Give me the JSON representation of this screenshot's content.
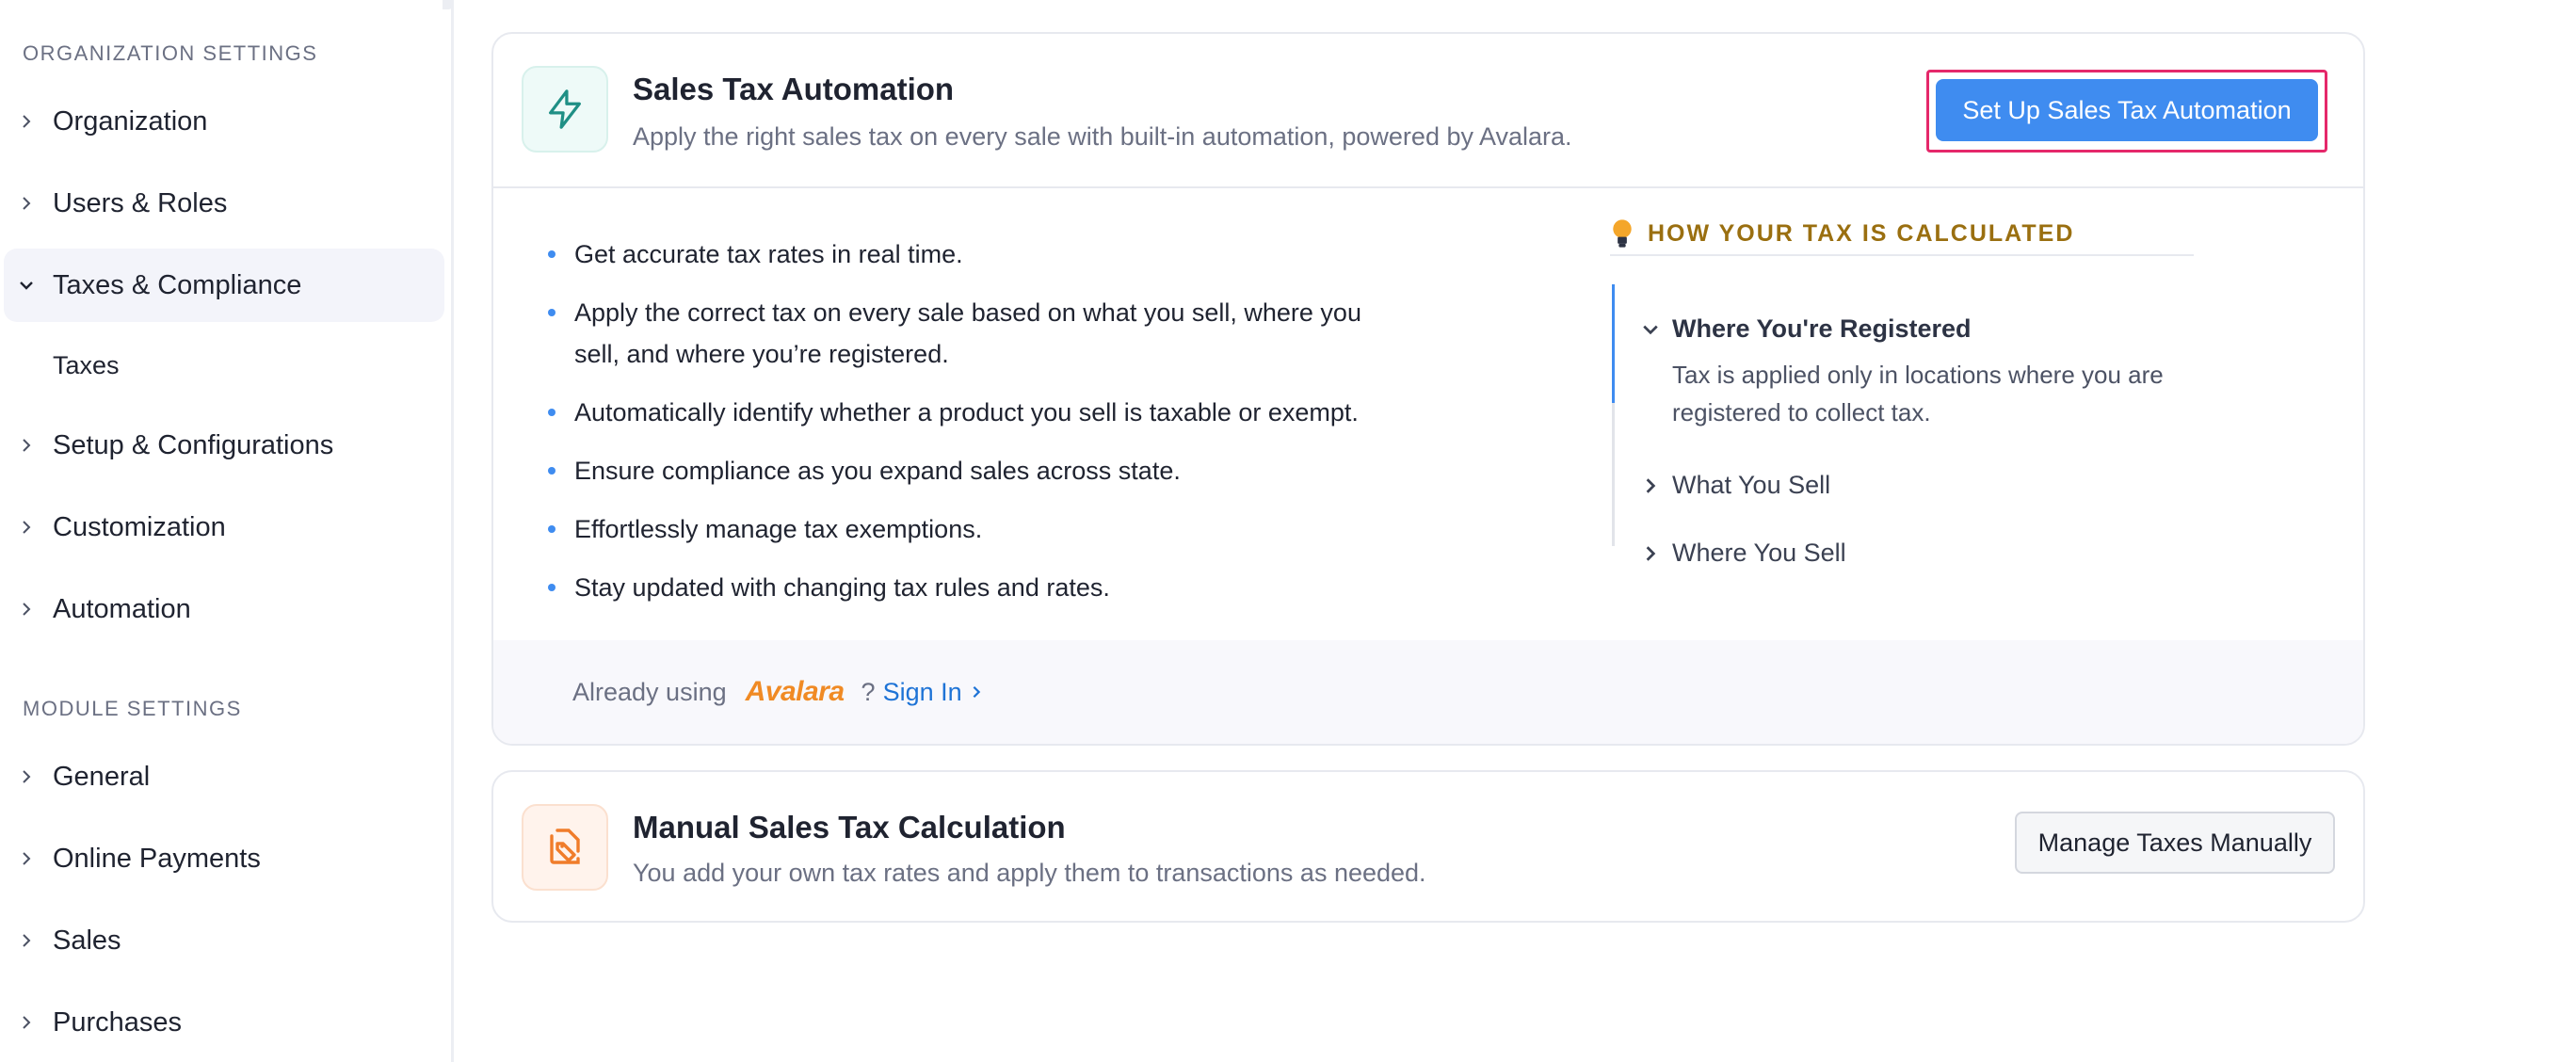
{
  "sidebar": {
    "org_section": "ORGANIZATION SETTINGS",
    "org_items": [
      {
        "label": "Organization"
      },
      {
        "label": "Users & Roles"
      },
      {
        "label": "Taxes & Compliance",
        "expanded": true
      },
      {
        "label": "Setup & Configurations"
      },
      {
        "label": "Customization"
      },
      {
        "label": "Automation"
      }
    ],
    "sub_item": "Taxes",
    "module_section": "MODULE SETTINGS",
    "module_items": [
      {
        "label": "General"
      },
      {
        "label": "Online Payments"
      },
      {
        "label": "Sales"
      },
      {
        "label": "Purchases"
      }
    ]
  },
  "automation_card": {
    "icon": "lightning-icon",
    "title": "Sales Tax Automation",
    "description": "Apply the right sales tax on every sale with built-in automation, powered by Avalara.",
    "button_label": "Set Up Sales Tax Automation",
    "bullets": [
      "Get accurate tax rates in real time.",
      "Apply the correct tax on every sale based on what you sell, where you sell, and where you’re registered.",
      "Automatically identify whether a product you sell is taxable or exempt.",
      "Ensure compliance as you expand sales across state.",
      "Effortlessly manage tax exemptions.",
      "Stay updated with changing tax rules and rates."
    ],
    "how": {
      "heading": "HOW YOUR TAX IS CALCULATED",
      "items": [
        {
          "label": "Where You're Registered",
          "expanded": true,
          "body": "Tax is applied only in locations where you are registered to collect tax."
        },
        {
          "label": "What You Sell",
          "expanded": false
        },
        {
          "label": "Where You Sell",
          "expanded": false
        }
      ]
    },
    "footer": {
      "prefix": "Already using",
      "brand": "Avalara",
      "question": "?",
      "sign_in": "Sign In"
    }
  },
  "manual_card": {
    "icon": "document-tag-icon",
    "title": "Manual Sales Tax Calculation",
    "description": "You add your own tax rates and apply them to transactions as needed.",
    "button_label": "Manage Taxes Manually"
  },
  "colors": {
    "accent": "#3f8cf0",
    "highlight": "#e5286a",
    "how_heading": "#9a6f10",
    "brand": "#f08a24",
    "link": "#1e73d6"
  }
}
